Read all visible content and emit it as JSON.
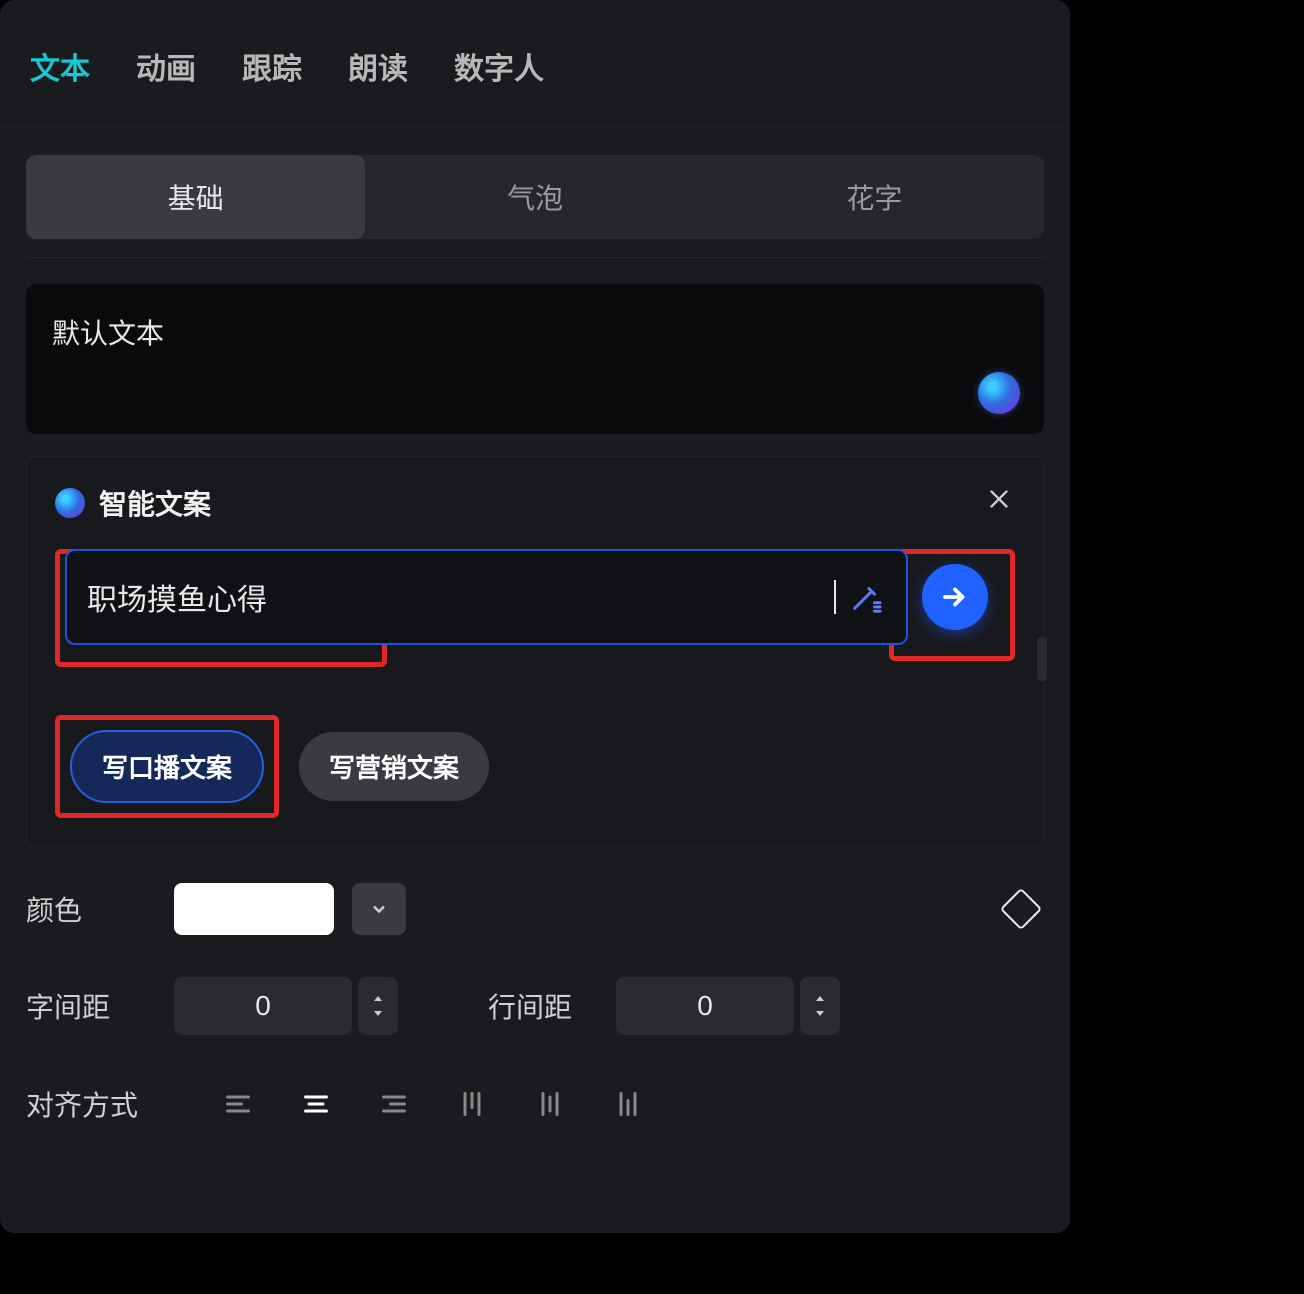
{
  "top_tabs": [
    "文本",
    "动画",
    "跟踪",
    "朗读",
    "数字人"
  ],
  "top_tabs_active_index": 0,
  "sub_tabs": [
    "基础",
    "气泡",
    "花字"
  ],
  "sub_tabs_active_index": 0,
  "textbox": {
    "value": "默认文本"
  },
  "ai_panel": {
    "title": "智能文案",
    "prompt_value": "职场摸鱼心得",
    "prompt_placeholder": "",
    "chips": [
      "写口播文案",
      "写营销文案"
    ],
    "chips_active_index": 0
  },
  "color": {
    "label": "颜色",
    "value": "#FFFFFF"
  },
  "spacing": {
    "letter_label": "字间距",
    "letter_value": "0",
    "line_label": "行间距",
    "line_value": "0"
  },
  "alignment": {
    "label": "对齐方式",
    "options": [
      "align-left",
      "align-center",
      "align-right",
      "align-top",
      "align-middle",
      "align-bottom"
    ],
    "active_index": 1
  }
}
